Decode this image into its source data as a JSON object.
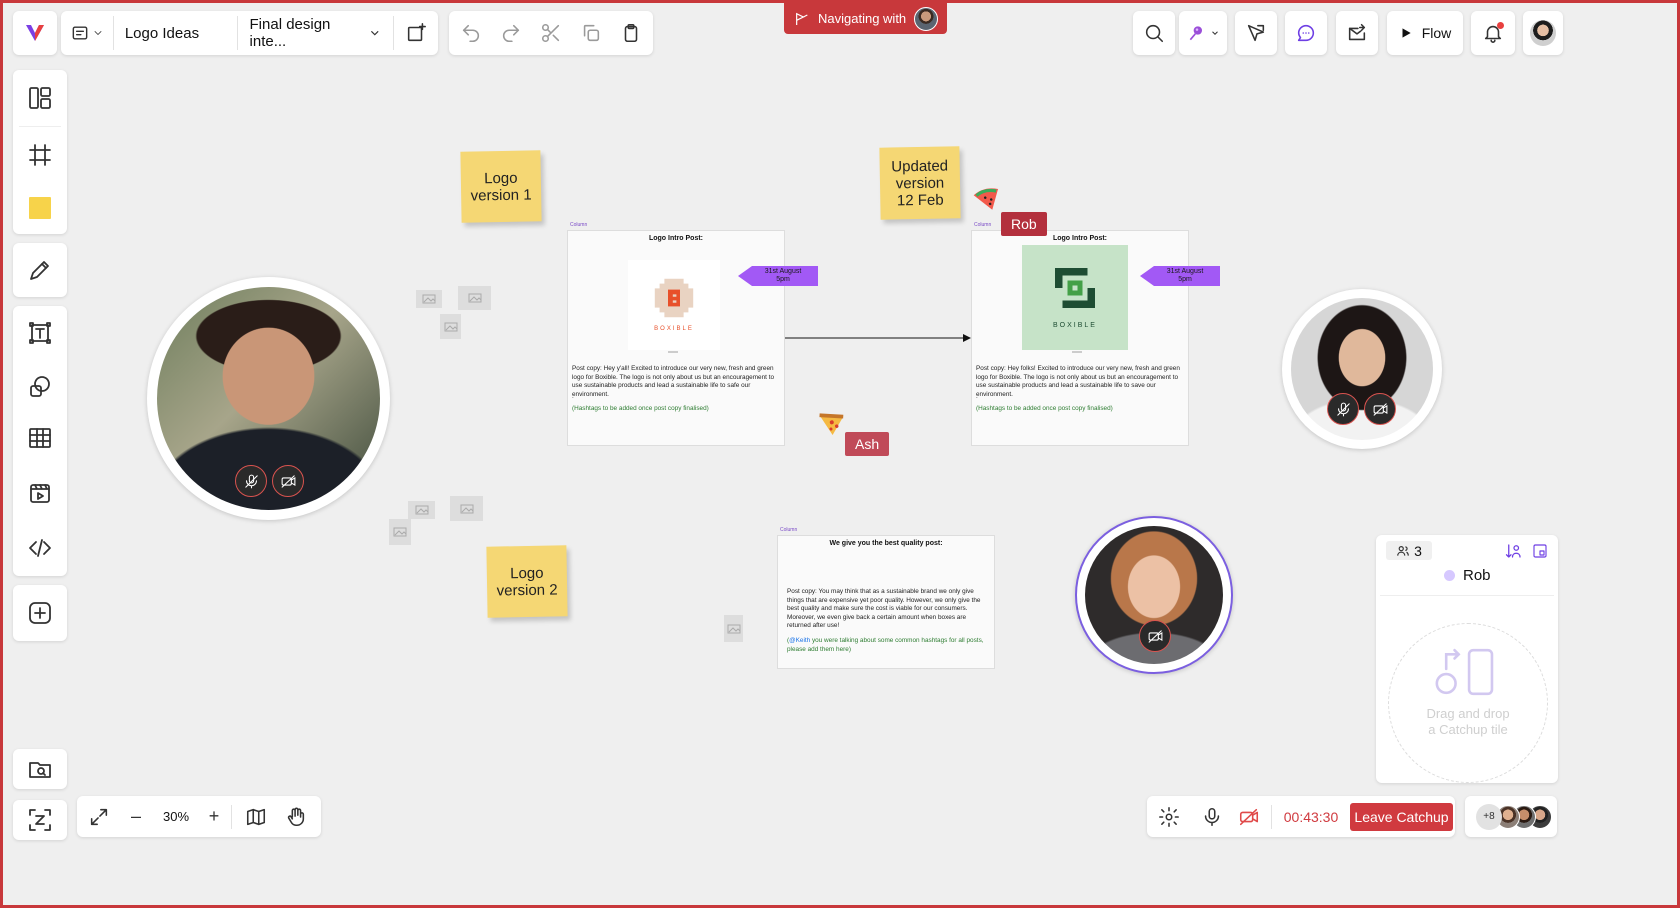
{
  "topbar": {
    "board_name": "Logo Ideas",
    "frame_select": "Final design inte...",
    "navigating_label": "Navigating with",
    "flow_label": "Flow"
  },
  "canvas": {
    "stickies": [
      {
        "text": "Logo\nversion 1"
      },
      {
        "text": "Updated\nversion\n12 Feb"
      },
      {
        "text": "Logo\nversion 2"
      }
    ],
    "cards": [
      {
        "label": "Column",
        "title": "Logo Intro Post:",
        "tag": "31st August\n5pm",
        "logo_word": "BOXIBLE",
        "post_copy": "Post copy: Hey y'all! Excited to introduce our very new, fresh and green logo for Boxible. The logo is not only about us but an encouragement to use sustainable products and lead a sustainable life to safe our environment.",
        "dot": ".",
        "hashtags": "(Hashtags to be added once post copy finalised)"
      },
      {
        "label": "Column",
        "title": "Logo Intro Post:",
        "tag": "31st August\n5pm",
        "logo_word": "BOXIBLE",
        "post_copy": "Post copy: Hey folks! Excited to introduce our very new, fresh and green logo for Boxible. The logo is not only about us but an encouragement to use sustainable products and lead a sustainable life to save our environment.",
        "dot": ".",
        "hashtags": "(Hashtags to be added once post copy finalised)"
      },
      {
        "label": "Column",
        "title": "We give you the best quality post:",
        "post_copy": "Post copy: You may think that as a sustainable brand we only give things that are expensive yet poor quality. However, we only give the best quality and make sure the cost is viable for our consumers. Moreover, we even give back a certain amount when boxes are returned after use!",
        "mention": "@Keith",
        "mention_rest": " you were talking about some common hashtags for all posts, please add them here)",
        "mention_open": "("
      }
    ],
    "cursors": [
      {
        "name": "Rob",
        "color": "#b3303d"
      },
      {
        "name": "Ash",
        "color": "#c04a58"
      }
    ]
  },
  "catchup_panel": {
    "participant_count": "3",
    "participant_name": "Rob",
    "drop_hint_line1": "Drag and drop",
    "drop_hint_line2": "a Catchup tile"
  },
  "zoom_bar": {
    "zoom_level": "30%",
    "minus": "–",
    "plus": "+"
  },
  "call_bar": {
    "timer": "00:43:30",
    "leave_label": "Leave Catchup",
    "extra_count": "+8"
  },
  "colors": {
    "accent_red": "#d03a3f",
    "sticky": "#f5d774",
    "tag_purple": "#a259f5",
    "brand_green": "#1e5b3a"
  }
}
